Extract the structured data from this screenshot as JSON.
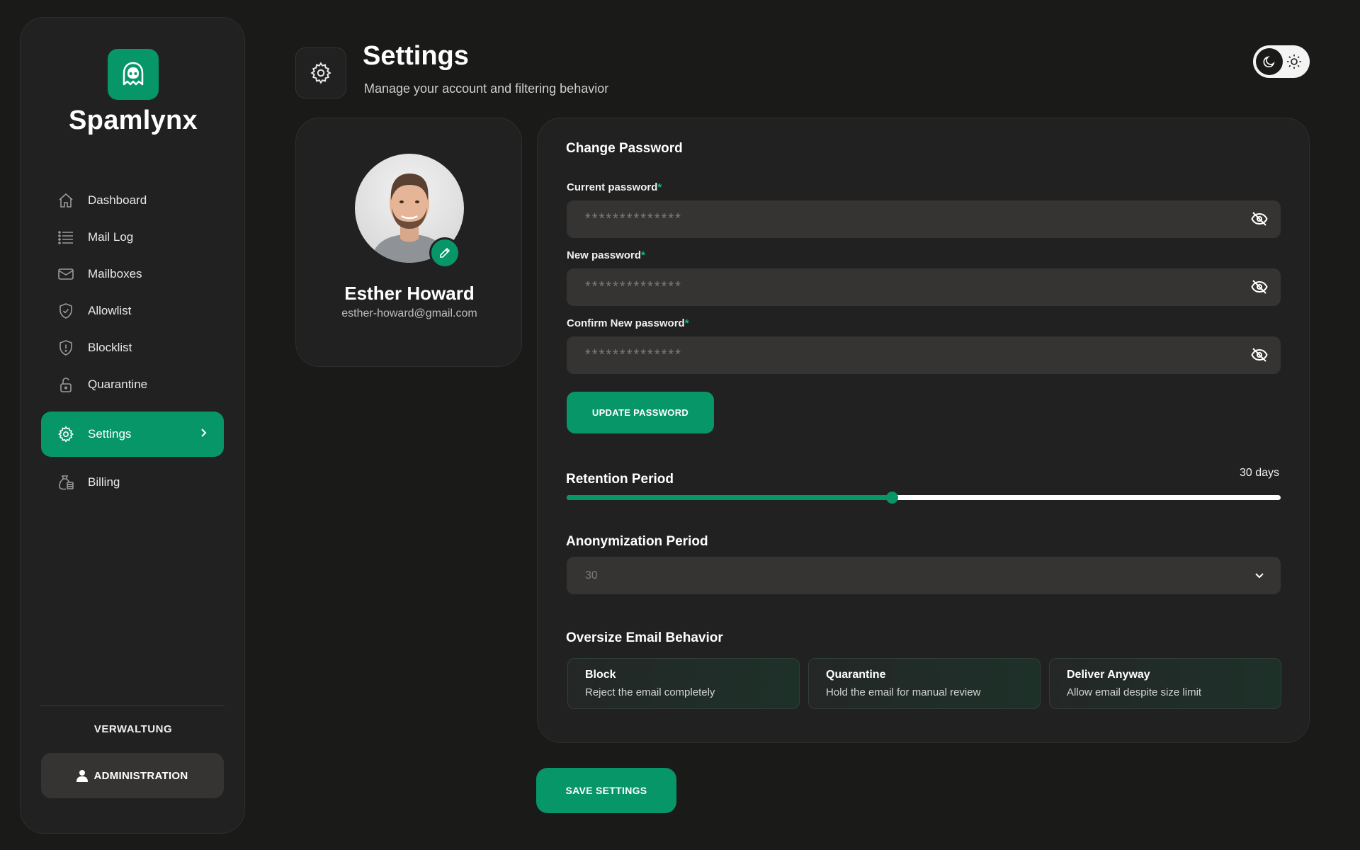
{
  "app": {
    "name": "Spamlynx",
    "accent_color": "#069668",
    "logo_icon": "ghost-icon"
  },
  "sidebar": {
    "items": [
      {
        "label": "Dashboard",
        "icon": "home-icon",
        "active": false
      },
      {
        "label": "Mail Log",
        "icon": "list-icon",
        "active": false
      },
      {
        "label": "Mailboxes",
        "icon": "mail-icon",
        "active": false
      },
      {
        "label": "Allowlist",
        "icon": "shield-check-icon",
        "active": false
      },
      {
        "label": "Blocklist",
        "icon": "shield-alert-icon",
        "active": false
      },
      {
        "label": "Quarantine",
        "icon": "unlock-icon",
        "active": false
      },
      {
        "label": "Settings",
        "icon": "gear-icon",
        "active": true
      },
      {
        "label": "Billing",
        "icon": "money-bag-icon",
        "active": false
      }
    ],
    "section_title": "VERWALTUNG",
    "admin_label": "ADMINISTRATION"
  },
  "header": {
    "title": "Settings",
    "subtitle": "Manage your account and filtering behavior",
    "theme": "dark"
  },
  "profile": {
    "name": "Esther Howard",
    "email": "esther-howard@gmail.com"
  },
  "password": {
    "title": "Change Password",
    "fields": [
      {
        "label": "Current password",
        "required": "*",
        "value": "**************"
      },
      {
        "label": "New password",
        "required": "*",
        "value": "**************"
      },
      {
        "label": "Confirm New password",
        "required": "*",
        "value": "**************"
      }
    ],
    "update_label": "UPDATE PASSWORD"
  },
  "retention": {
    "title": "Retention Period",
    "value_label": "30 days",
    "fraction": 0.455
  },
  "anonymization": {
    "title": "Anonymization Period",
    "selected": "30"
  },
  "oversize": {
    "title": "Oversize Email Behavior",
    "options": [
      {
        "title": "Block",
        "desc": "Reject the email completely"
      },
      {
        "title": "Quarantine",
        "desc": "Hold the email for manual review"
      },
      {
        "title": "Deliver Anyway",
        "desc": "Allow email despite size limit"
      }
    ]
  },
  "save_label": "SAVE SETTINGS"
}
